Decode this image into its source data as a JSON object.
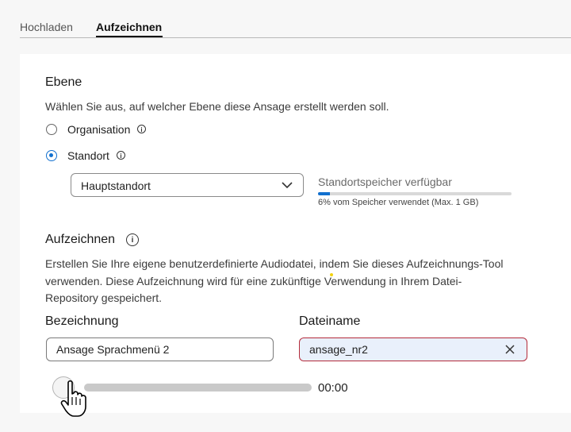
{
  "tabs": [
    {
      "label": "Hochladen",
      "active": false
    },
    {
      "label": "Aufzeichnen",
      "active": true
    }
  ],
  "level": {
    "heading": "Ebene",
    "description": "Wählen Sie aus, auf welcher Ebene diese Ansage erstellt werden soll.",
    "options": [
      {
        "label": "Organisation",
        "checked": false
      },
      {
        "label": "Standort",
        "checked": true
      }
    ]
  },
  "location_select": {
    "value": "Hauptstandort"
  },
  "storage": {
    "title": "Standortspeicher verfügbar",
    "usage_text": "6% vom Speicher verwendet (Max. 1 GB)",
    "used_percent": 6
  },
  "record": {
    "heading": "Aufzeichnen",
    "description_lines": [
      "Erstellen Sie Ihre eigene benutzerdefinierte Audiodatei, indem Sie dieses Aufzeichnungs-Tool",
      "verwenden. Diese Aufzeichnung wird für eine zukünftige Verwendung in Ihrem Datei-",
      "Repository gespeichert."
    ]
  },
  "fields": {
    "name_label": "Bezeichnung",
    "name_value": "Ansage Sprachmenü 2",
    "filename_label": "Dateiname",
    "filename_value": "ansage_nr2"
  },
  "player": {
    "time": "00:00",
    "progress": 0
  },
  "icons": {
    "info": "info-icon",
    "chevron": "chevron-down-icon",
    "clear": "close-icon",
    "record": "record-button"
  },
  "colors": {
    "accent": "#1170cf",
    "error_border": "#b42b3a",
    "error_bg": "#e9f0fb"
  }
}
